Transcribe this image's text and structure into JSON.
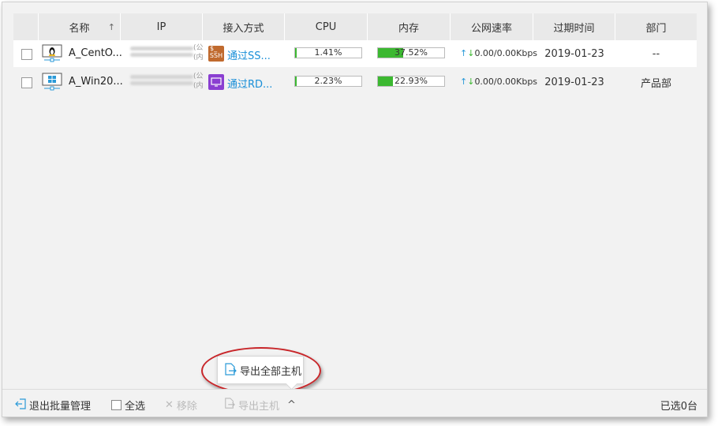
{
  "table": {
    "headers": {
      "name": "名称",
      "sort_arrow": "↑",
      "ip": "IP",
      "access": "接入方式",
      "cpu": "CPU",
      "memory": "内存",
      "net": "公网速率",
      "expire": "过期时间",
      "dept": "部门"
    },
    "rows": [
      {
        "os_icon": "linux-penguin-icon",
        "name": "A_CentO...",
        "ip_side_1": "(公",
        "ip_side_2": "(内",
        "access_icon": "ssh-icon",
        "access_icon_text": "SSH",
        "access": "通过SS...",
        "cpu": "1.41%",
        "cpu_value": 1.41,
        "mem": "37.52%",
        "mem_value": 37.52,
        "net": "0.00/0.00Kbps",
        "expire": "2019-01-23",
        "dept": "--"
      },
      {
        "os_icon": "windows-icon",
        "name": "A_Win20...",
        "ip_side_1": "(公",
        "ip_side_2": "(内",
        "access_icon": "rdp-icon",
        "access_icon_text": "RDP",
        "access": "通过RD...",
        "cpu": "2.23%",
        "cpu_value": 2.23,
        "mem": "22.93%",
        "mem_value": 22.93,
        "net": "0.00/0.00Kbps",
        "expire": "2019-01-23",
        "dept": "产品部"
      }
    ]
  },
  "popup": {
    "icon": "export-file-icon",
    "label": "导出全部主机"
  },
  "footer": {
    "exit": "退出批量管理",
    "select_all": "全选",
    "remove": "移除",
    "export": "导出主机",
    "export_caret": "^",
    "selected": "已选0台"
  },
  "colors": {
    "link": "#1a8fd8",
    "bar_fill": "#3cb831",
    "ssh_icon": "#c06a2e",
    "rdp_icon": "#8a3fd1",
    "highlight": "#c8262a"
  }
}
